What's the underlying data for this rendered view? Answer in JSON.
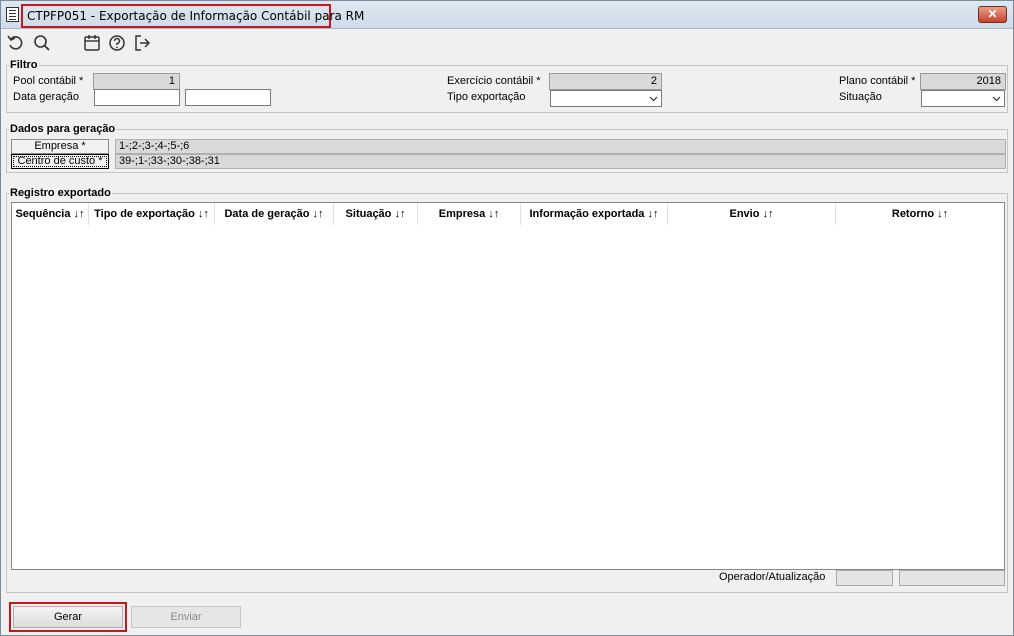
{
  "window": {
    "title": "CTPFP051 - Exportação de Informação Contábil para RM",
    "close_label": "✕"
  },
  "toolbar": {
    "icons": [
      "refresh-icon",
      "search-icon",
      "calendar-icon",
      "help-icon",
      "exit-icon"
    ]
  },
  "filtro": {
    "legend": "Filtro",
    "pool_contabil_label": "Pool contábil *",
    "pool_contabil_value": "1",
    "data_geracao_label": "Data geração",
    "data_geracao_start": "",
    "data_geracao_end": "",
    "exercicio_label": "Exercício contábil *",
    "exercicio_value": "2",
    "tipo_exportacao_label": "Tipo exportação",
    "tipo_exportacao_value": "",
    "plano_label": "Plano contábil *",
    "plano_value": "2018",
    "situacao_label": "Situação",
    "situacao_value": ""
  },
  "dados": {
    "legend": "Dados para geração",
    "empresa_button": "Empresa *",
    "empresa_value": "1-;2-;3-;4-;5-;6",
    "centro_button": "Centro de custo *",
    "centro_value": "39-;1-;33-;30-;38-;31"
  },
  "registro": {
    "legend": "Registro exportado",
    "columns": [
      "Sequência ↓↑",
      "Tipo de exportação ↓↑",
      "Data de geração ↓↑",
      "Situação ↓↑",
      "Empresa ↓↑",
      "Informação exportada ↓↑",
      "Envio ↓↑",
      "Retorno ↓↑"
    ],
    "rows": [],
    "operador_label": "Operador/Atualização",
    "operador_value": "",
    "atualizacao_value": ""
  },
  "actions": {
    "gerar_label": "Gerar",
    "enviar_label": "Enviar"
  },
  "colors": {
    "highlight": "#c8181e",
    "readonly_bg": "#d9d9d9",
    "window_bg": "#f0f0f0"
  }
}
